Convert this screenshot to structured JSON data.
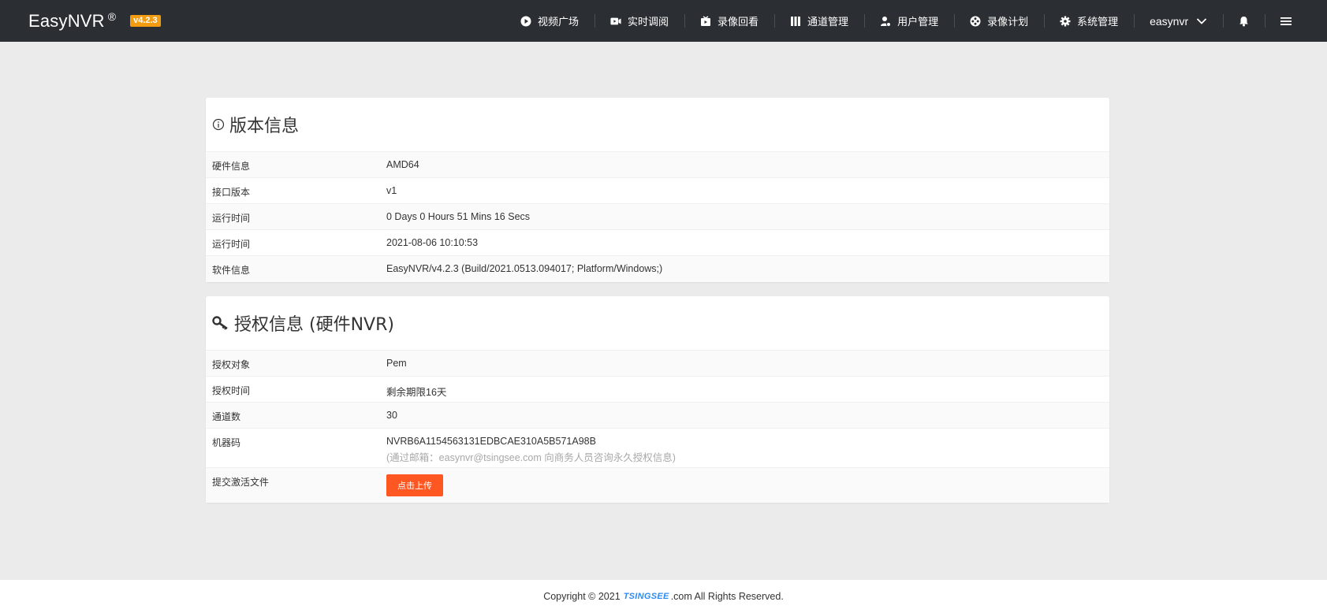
{
  "header": {
    "brand": "EasyNVR",
    "reg": "®",
    "version": "v4.2.3",
    "nav": [
      {
        "label": "视频广场",
        "icon": "play-circle-icon"
      },
      {
        "label": "实时调阅",
        "icon": "video-camera-icon"
      },
      {
        "label": "录像回看",
        "icon": "playback-icon"
      },
      {
        "label": "通道管理",
        "icon": "channels-icon"
      },
      {
        "label": "用户管理",
        "icon": "user-gear-icon"
      },
      {
        "label": "录像计划",
        "icon": "film-reel-icon"
      },
      {
        "label": "系统管理",
        "icon": "gear-icon"
      }
    ],
    "user": "easynvr"
  },
  "version_card": {
    "title": "版本信息",
    "rows": [
      {
        "label": "硬件信息",
        "value": "AMD64"
      },
      {
        "label": "接口版本",
        "value": "v1"
      },
      {
        "label": "运行时间",
        "value": "0 Days 0 Hours 51 Mins 16 Secs"
      },
      {
        "label": "运行时间",
        "value": "2021-08-06 10:10:53"
      },
      {
        "label": "软件信息",
        "value": "EasyNVR/v4.2.3 (Build/2021.0513.094017; Platform/Windows;)"
      }
    ]
  },
  "license_card": {
    "title": "授权信息 (硬件NVR)",
    "rows": [
      {
        "label": "授权对象",
        "value": "Pem"
      },
      {
        "label": "授权时间",
        "value": "剩余期限16天"
      },
      {
        "label": "通道数",
        "value": "30"
      },
      {
        "label": "机器码",
        "value": "NVRB6A1154563131EDBCAE310A5B571A98B",
        "note": "(通过邮箱：easynvr@tsingsee.com 向商务人员咨询永久授权信息)"
      }
    ],
    "upload_label": "提交激活文件",
    "upload_button": "点击上传"
  },
  "footer": {
    "prefix": "Copyright © 2021",
    "logo": "TSINGSEE",
    "suffix": ".com All Rights Reserved."
  },
  "colors": {
    "topbar": "#2b2f33",
    "badge": "#f39c12",
    "upload_button": "#ff5722",
    "background": "#ebebeb"
  }
}
